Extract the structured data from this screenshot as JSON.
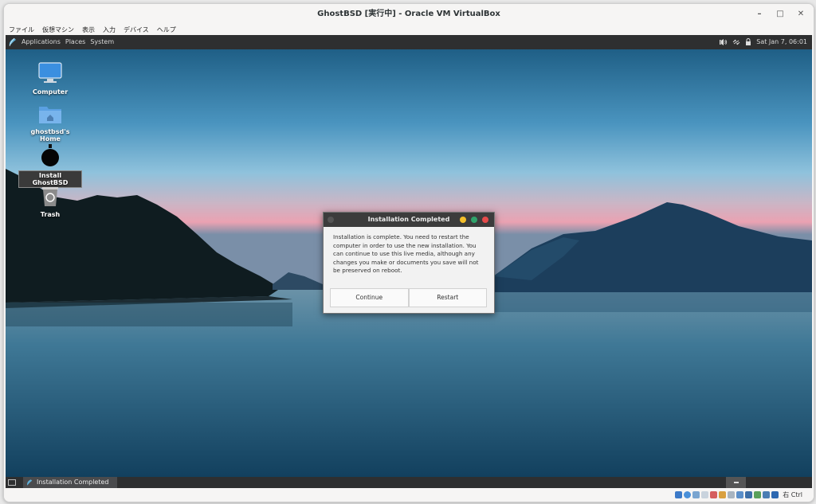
{
  "window": {
    "title": "GhostBSD [実行中] - Oracle VM VirtualBox",
    "minimize_glyph": "–",
    "maximize_glyph": "□",
    "close_glyph": "✕"
  },
  "menubar": [
    "ファイル",
    "仮想マシン",
    "表示",
    "入力",
    "デバイス",
    "ヘルプ"
  ],
  "panel": {
    "menus": [
      "Applications",
      "Places",
      "System"
    ],
    "clock": "Sat Jan  7, 06:01"
  },
  "desktop_icons": [
    {
      "label": "Computer",
      "icon": "computer-icon"
    },
    {
      "label": "ghostbsd's Home",
      "icon": "home-folder-icon"
    },
    {
      "label": "Install GhostBSD",
      "icon": "install-icon"
    },
    {
      "label": "Trash",
      "icon": "trash-icon"
    }
  ],
  "dialog": {
    "title": "Installation Completed",
    "message": "Installation is complete. You need to restart the computer in order to use the new installation. You can continue to use this live media, although any changes you make or documents you save will not be preserved on reboot.",
    "continue_label": "Continue",
    "restart_label": "Restart"
  },
  "taskbar": {
    "item_label": "Installation Completed"
  },
  "statusbar": {
    "host_key": "右 Ctrl"
  },
  "colors": {
    "panel": "#2e2f30",
    "dialog_title": "#3c3c3c",
    "btn_yellow": "#f4bf2a",
    "btn_green": "#2fa36b",
    "btn_red": "#e64b4b"
  }
}
